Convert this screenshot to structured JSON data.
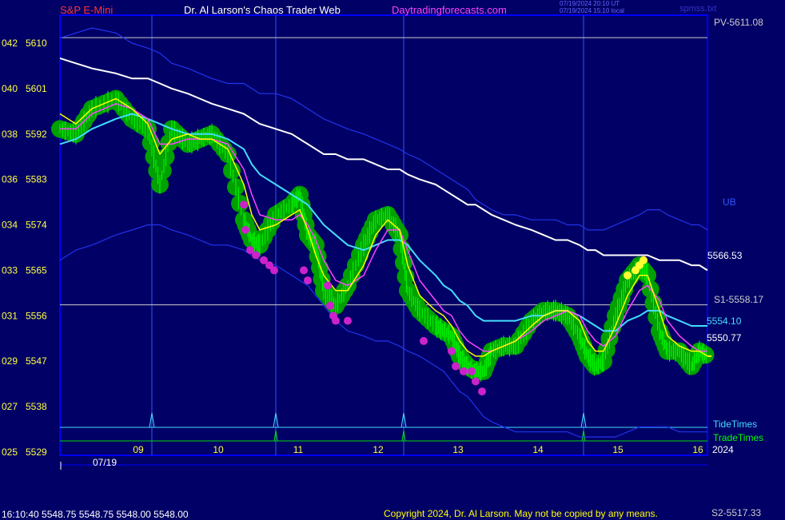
{
  "header": {
    "symbol": "S&P E-Mini",
    "web_title": "Dr. Al Larson's Chaos Trader Web",
    "site": "Daytradingforecasts.com",
    "time_ut": "07/19/2024 20:10 UT",
    "time_local": "07/19/2024 15:10 local",
    "file": "spmss.txt"
  },
  "footer": {
    "quote": "16:10:40  5548.75 5548.75 5548.00 5548.00",
    "copyright": "Copyright 2024, Dr. Al Larson. May not be copied by any means.",
    "s2": "S2-5517.33"
  },
  "colors": {
    "background": "#000066",
    "frame": "#0000ff",
    "price_bars": "#00ff00",
    "cloud": "#00a000",
    "fast_avg": "#ffff00",
    "mid_avg": "#ff44ff",
    "slow_avg": "#44ddff",
    "long_avg": "#ffffff",
    "band": "#2233ee",
    "dots_magenta": "#cc22cc",
    "dots_yellow": "#ffff33"
  },
  "chart_data": {
    "type": "line",
    "y_axis": {
      "min": 5529,
      "max": 5613,
      "ticks": [
        5610,
        5601,
        5592,
        5583,
        5574,
        5565,
        5556,
        5547,
        5538,
        5529
      ],
      "left_labels": [
        "042",
        "040",
        "038",
        "036",
        "034",
        "033",
        "031",
        "029",
        "027",
        "025"
      ]
    },
    "x_axis": {
      "min": 8.0,
      "max": 16.1,
      "hour_ticks": [
        9,
        10,
        11,
        12,
        13,
        14,
        15,
        16
      ],
      "hour_labels": [
        "09",
        "10",
        "11",
        "12",
        "13",
        "14",
        "15",
        "16"
      ],
      "date_label": "07/19",
      "year_label": "2024"
    },
    "levels": [
      {
        "name": "PV",
        "value": 5611.08,
        "label": "PV-5611.08"
      },
      {
        "name": "S1",
        "value": 5558.17,
        "label": "S1-5558.17"
      },
      {
        "name": "S2",
        "value": 5517.33,
        "label": "S2-5517.33"
      }
    ],
    "value_labels": [
      {
        "text": "5566.53",
        "value": 5566.53
      },
      {
        "text": "5554.10",
        "value": 5554.1
      },
      {
        "text": "5550.77",
        "value": 5550.77
      }
    ],
    "ub_label": "UB",
    "tide_label": "TideTimes",
    "trade_label": "TradeTimes",
    "tide_times": [
      9.15,
      10.7,
      12.3,
      14.55
    ],
    "trade_times": [
      10.7,
      12.3,
      14.55
    ],
    "price": {
      "x": [
        8.0,
        8.2,
        8.4,
        8.7,
        8.9,
        9.1,
        9.25,
        9.4,
        9.6,
        9.75,
        9.9,
        10.1,
        10.3,
        10.4,
        10.5,
        10.7,
        10.9,
        11.0,
        11.1,
        11.2,
        11.3,
        11.45,
        11.6,
        11.8,
        11.95,
        12.1,
        12.25,
        12.35,
        12.5,
        12.7,
        12.8,
        12.9,
        13.0,
        13.1,
        13.2,
        13.3,
        13.4,
        13.55,
        13.7,
        13.9,
        14.05,
        14.2,
        14.35,
        14.5,
        14.6,
        14.7,
        14.8,
        14.95,
        15.1,
        15.25,
        15.35,
        15.5,
        15.6,
        15.75,
        15.9,
        16.0,
        16.1
      ],
      "y": [
        5593,
        5592,
        5597,
        5599,
        5595,
        5593,
        5582,
        5593,
        5590,
        5591,
        5592,
        5588,
        5575,
        5571,
        5570,
        5576,
        5578,
        5580,
        5572,
        5570,
        5561,
        5558,
        5562,
        5570,
        5575,
        5576,
        5572,
        5561,
        5557,
        5554,
        5553,
        5552,
        5548,
        5546,
        5545,
        5545,
        5549,
        5550,
        5550,
        5555,
        5557,
        5557,
        5556,
        5552,
        5548,
        5546,
        5547,
        5556,
        5563,
        5566,
        5564,
        5553,
        5549,
        5549,
        5546,
        5549,
        5548
      ]
    },
    "series": [
      {
        "values": [
          5596,
          5594,
          5597,
          5599,
          5597,
          5594,
          5588,
          5591,
          5592,
          5591,
          5591,
          5589,
          5582,
          5576,
          5573,
          5574,
          5576,
          5577,
          5573,
          5568,
          5564,
          5561,
          5561,
          5566,
          5572,
          5575,
          5573,
          5566,
          5560,
          5557,
          5556,
          5554,
          5551,
          5549,
          5548,
          5548,
          5549,
          5550,
          5551,
          5554,
          5556,
          5557,
          5557,
          5555,
          5551,
          5549,
          5549,
          5554,
          5560,
          5564,
          5564,
          5557,
          5552,
          5550,
          5549,
          5549,
          5548
        ]
      },
      {
        "values": [
          5593,
          5593,
          5596,
          5598,
          5597,
          5595,
          5590,
          5590,
          5591,
          5591,
          5591,
          5590,
          5585,
          5580,
          5576,
          5575,
          5575,
          5576,
          5574,
          5571,
          5567,
          5563,
          5562,
          5564,
          5569,
          5573,
          5573,
          5569,
          5563,
          5559,
          5557,
          5556,
          5553,
          5551,
          5550,
          5549,
          5549,
          5550,
          5551,
          5553,
          5555,
          5556,
          5557,
          5556,
          5553,
          5551,
          5550,
          5552,
          5557,
          5561,
          5562,
          5559,
          5555,
          5552,
          5550,
          5549,
          5549
        ]
      },
      {
        "values": [
          5590,
          5591,
          5593,
          5595,
          5596,
          5595,
          5594,
          5593,
          5592,
          5592,
          5592,
          5591,
          5589,
          5586,
          5584,
          5582,
          5580,
          5579,
          5578,
          5576,
          5574,
          5572,
          5570,
          5569,
          5570,
          5571,
          5571,
          5570,
          5567,
          5564,
          5562,
          5561,
          5559,
          5558,
          5556,
          5555,
          5555,
          5555,
          5555,
          5556,
          5556,
          5557,
          5557,
          5556,
          5555,
          5554,
          5553,
          5553,
          5555,
          5556,
          5557,
          5557,
          5556,
          5555,
          5554,
          5554,
          5554
        ]
      },
      {
        "values": [
          5607,
          5606,
          5605,
          5604,
          5603,
          5603,
          5602,
          5601,
          5600,
          5599,
          5598,
          5597,
          5596,
          5595,
          5594,
          5593,
          5592,
          5591,
          5590,
          5589,
          5588,
          5588,
          5587,
          5587,
          5586,
          5585,
          5585,
          5584,
          5583,
          5582,
          5581,
          5580,
          5579,
          5578,
          5578,
          5577,
          5576,
          5575,
          5574,
          5573,
          5572,
          5571,
          5571,
          5570,
          5569,
          5569,
          5568,
          5568,
          5568,
          5568,
          5568,
          5567,
          5567,
          5567,
          5566,
          5566,
          5565
        ]
      },
      {
        "values": [
          5611,
          5612,
          5613,
          5612,
          5610,
          5609,
          5608,
          5606,
          5605,
          5604,
          5603,
          5602,
          5602,
          5601,
          5600,
          5600,
          5599,
          5598,
          5597,
          5596,
          5595,
          5594,
          5593,
          5592,
          5591,
          5590,
          5589,
          5588,
          5587,
          5585,
          5584,
          5583,
          5582,
          5581,
          5579,
          5578,
          5577,
          5576,
          5576,
          5575,
          5575,
          5575,
          5574,
          5574,
          5573,
          5573,
          5573,
          5574,
          5575,
          5576,
          5577,
          5577,
          5576,
          5575,
          5574,
          5574,
          5573
        ]
      },
      {
        "values": [
          5567,
          5569,
          5570,
          5572,
          5573,
          5574,
          5574,
          5573,
          5572,
          5571,
          5570,
          5570,
          5569,
          5568,
          5567,
          5566,
          5564,
          5563,
          5562,
          5560,
          5558,
          5555,
          5553,
          5552,
          5551,
          5551,
          5550,
          5549,
          5548,
          5546,
          5545,
          5543,
          5541,
          5540,
          5538,
          5536,
          5535,
          5534,
          5533,
          5533,
          5533,
          5533,
          5533,
          5532,
          5532,
          5532,
          5532,
          5532,
          5533,
          5534,
          5534,
          5534,
          5534,
          5533,
          5533,
          5533,
          5533
        ]
      }
    ],
    "magenta_dots": [
      [
        10.3,
        5578
      ],
      [
        10.32,
        5573
      ],
      [
        10.38,
        5569
      ],
      [
        10.45,
        5568
      ],
      [
        10.55,
        5567
      ],
      [
        10.62,
        5566
      ],
      [
        10.68,
        5565
      ],
      [
        11.05,
        5565
      ],
      [
        11.1,
        5563
      ],
      [
        11.35,
        5562
      ],
      [
        11.38,
        5558
      ],
      [
        11.42,
        5556
      ],
      [
        11.45,
        5555
      ],
      [
        11.6,
        5555
      ],
      [
        12.55,
        5551
      ],
      [
        12.9,
        5549
      ],
      [
        12.95,
        5546
      ],
      [
        13.05,
        5545
      ],
      [
        13.15,
        5545
      ],
      [
        13.2,
        5543
      ],
      [
        13.28,
        5541
      ]
    ],
    "yellow_dots": [
      [
        15.1,
        5564
      ],
      [
        15.2,
        5565
      ],
      [
        15.25,
        5566
      ],
      [
        15.3,
        5567
      ]
    ]
  }
}
